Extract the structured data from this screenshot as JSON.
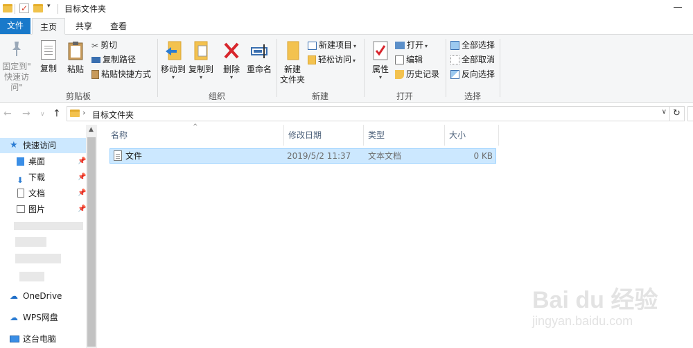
{
  "window": {
    "title": "目标文件夹"
  },
  "tabs": {
    "file": "文件",
    "home": "主页",
    "share": "共享",
    "view": "查看"
  },
  "ribbon": {
    "clipboard": {
      "label": "剪贴板",
      "pin_line1": "固定到\"",
      "pin_line2": "快速访问\"",
      "copy": "复制",
      "paste": "粘贴",
      "cut": "剪切",
      "copy_path": "复制路径",
      "paste_shortcut": "粘贴快捷方式"
    },
    "organize": {
      "label": "组织",
      "move_to": "移动到",
      "copy_to": "复制到",
      "delete": "删除",
      "rename": "重命名"
    },
    "new": {
      "label": "新建",
      "new_folder_line1": "新建",
      "new_folder_line2": "文件夹",
      "new_item": "新建项目",
      "easy_access": "轻松访问"
    },
    "open": {
      "label": "打开",
      "properties": "属性",
      "open": "打开",
      "edit": "编辑",
      "history": "历史记录"
    },
    "select": {
      "label": "选择",
      "select_all": "全部选择",
      "select_none": "全部取消",
      "invert": "反向选择"
    }
  },
  "address": {
    "path": "目标文件夹"
  },
  "navpane": {
    "quick_access": "快速访问",
    "items": [
      {
        "label": "桌面"
      },
      {
        "label": "下载"
      },
      {
        "label": "文档"
      },
      {
        "label": "图片"
      }
    ],
    "onedrive": "OneDrive",
    "wps": "WPS网盘",
    "this_pc": "这台电脑"
  },
  "filelist": {
    "columns": {
      "name": "名称",
      "modified": "修改日期",
      "type": "类型",
      "size": "大小"
    },
    "rows": [
      {
        "name": "文件",
        "modified": "2019/5/2 11:37",
        "type": "文本文档",
        "size": "0 KB"
      }
    ]
  },
  "watermark": {
    "main": "Bai du 经验",
    "sub": "jingyan.baidu.com"
  },
  "colors": {
    "accent": "#1979ca",
    "selection": "#cce8ff",
    "folder": "#f3c24f"
  }
}
